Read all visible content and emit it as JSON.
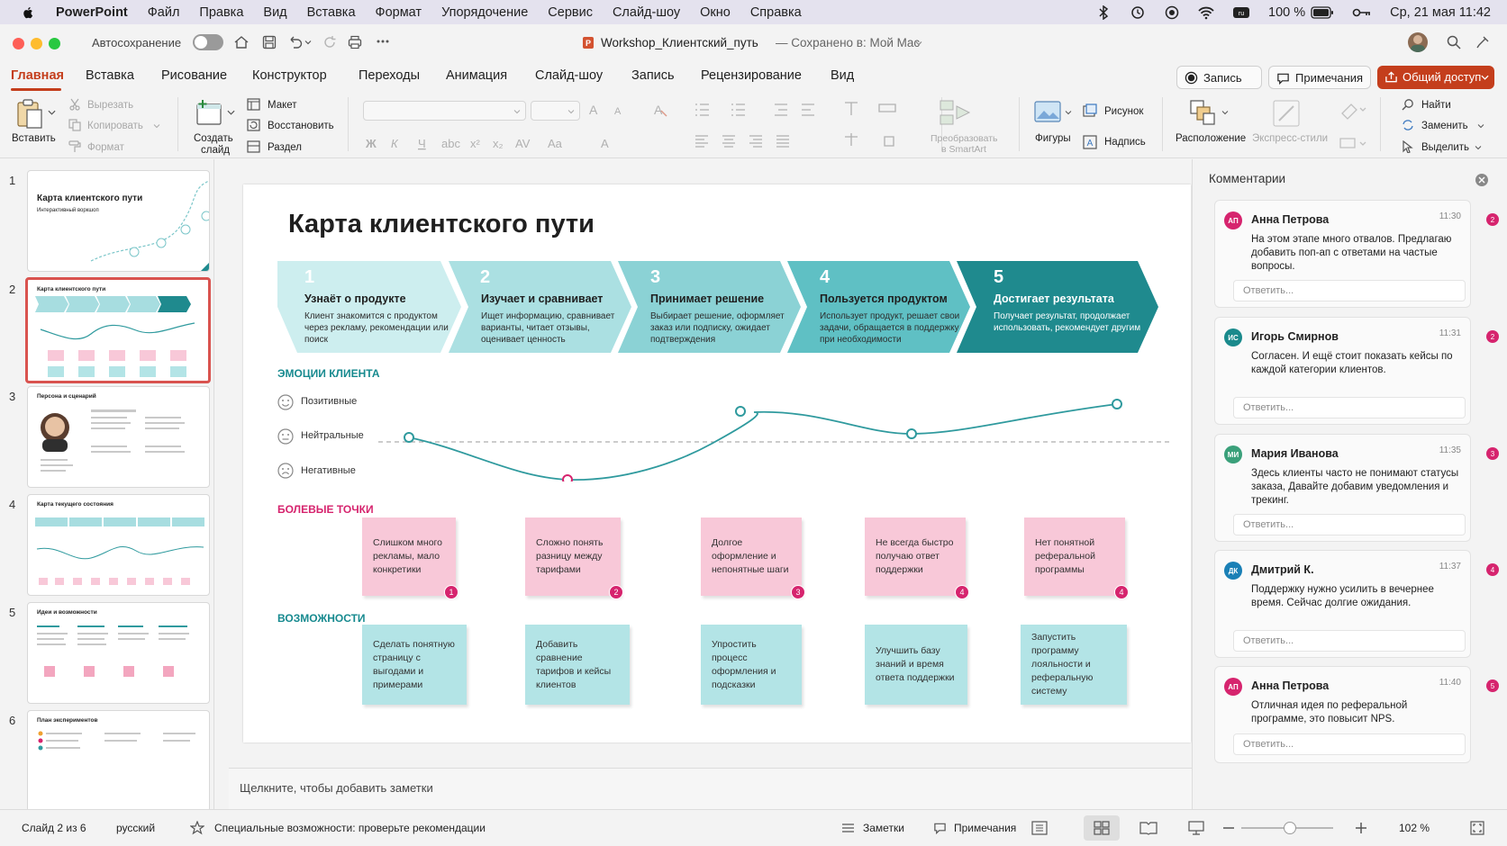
{
  "menubar": {
    "app": "PowerPoint",
    "items": [
      "Файл",
      "Правка",
      "Вид",
      "Вставка",
      "Формат",
      "Упорядочение",
      "Сервис",
      "Слайд-шоу",
      "Окно",
      "Справка"
    ],
    "battery": "100 %",
    "datetime": "Ср, 21 мая  11:42"
  },
  "titlebar": {
    "autosave_label": "Автосохранение",
    "doc_title": "Workshop_Клиентский_путь",
    "saved_status": "— Сохранено в: Мой Mac"
  },
  "tabs": [
    "Главная",
    "Вставка",
    "Рисование",
    "Конструктор",
    "Переходы",
    "Анимация",
    "Слайд-шоу",
    "Запись",
    "Рецензирование",
    "Вид"
  ],
  "header_buttons": {
    "record": "Запись",
    "comments": "Примечания",
    "share": "Общий доступ"
  },
  "ribbon": {
    "paste": "Вставить",
    "cut": "Вырезать",
    "copy": "Копировать",
    "format": "Формат",
    "new_slide_1": "Создать",
    "new_slide_2": "слайд",
    "layout": "Макет",
    "reset": "Восстановить",
    "section": "Раздел",
    "smartart_1": "Преобразовать",
    "smartart_2": "в SmartArt",
    "shapes": "Фигуры",
    "picture": "Рисунок",
    "textbox": "Надпись",
    "arrange": "Расположение",
    "quick_styles": "Экспресс-стили",
    "find": "Найти",
    "replace": "Заменить",
    "select": "Выделить"
  },
  "thumbnails": [
    {
      "num": "1",
      "title": "Карта клиентского пути",
      "subtitle": "Интерактивный воркшоп"
    },
    {
      "num": "2",
      "title": "Карта клиентского пути"
    },
    {
      "num": "3",
      "title": "Персона и сценарий"
    },
    {
      "num": "4",
      "title": "Карта текущего состояния"
    },
    {
      "num": "5",
      "title": "Идеи и возможности"
    },
    {
      "num": "6",
      "title": "План экспериментов"
    }
  ],
  "slide": {
    "title": "Карта клиентского пути",
    "stages": [
      {
        "num": "1",
        "title": "Узнаёт о продукте",
        "desc": "Клиент знакомится с продуктом через рекламу, рекомендации или поиск"
      },
      {
        "num": "2",
        "title": "Изучает и сравнивает",
        "desc": "Ищет информацию, сравнивает варианты, читает отзывы, оценивает ценность"
      },
      {
        "num": "3",
        "title": "Принимает решение",
        "desc": "Выбирает решение, оформляет заказ или подписку, ожидает подтверждения"
      },
      {
        "num": "4",
        "title": "Пользуется продуктом",
        "desc": "Использует продукт, решает свои задачи, обращается в поддержку при необходимости"
      },
      {
        "num": "5",
        "title": "Достигает результата",
        "desc": "Получает результат, продолжает использовать, рекомендует другим"
      }
    ],
    "emotions_title": "ЭМОЦИИ КЛИЕНТА",
    "emotion_levels": [
      "Позитивные",
      "Нейтральные",
      "Негативные"
    ],
    "pain_title": "БОЛЕВЫЕ ТОЧКИ",
    "pain_points": [
      {
        "text": "Слишком много рекламы, мало конкретики",
        "badge": "1"
      },
      {
        "text": "Сложно понять разницу между тарифами",
        "badge": "2"
      },
      {
        "text": "Долгое оформление и непонятные шаги",
        "badge": "3"
      },
      {
        "text": "Не всегда быстро получаю ответ поддержки",
        "badge": "4"
      },
      {
        "text": "Нет понятной реферальной программы",
        "badge": "4"
      }
    ],
    "opp_title": "ВОЗМОЖНОСТИ",
    "opportunities": [
      "Сделать понятную страницу с выгодами и примерами",
      "Добавить сравнение тарифов и кейсы клиентов",
      "Упростить процесс оформления и подсказки",
      "Улучшить базу знаний и время ответа поддержки",
      "Запустить программу лояльности и реферальную систему"
    ]
  },
  "notes_placeholder": "Щелкните, чтобы добавить заметки",
  "comments_panel": {
    "title": "Комментарии",
    "reply_placeholder": "Ответить...",
    "items": [
      {
        "initials": "АП",
        "author": "Анна Петрова",
        "time": "11:30",
        "text": "На этом этапе много отвалов. Предлагаю добавить поп-ап с ответами на частые вопросы.",
        "badge": "2",
        "color": "#d6246e"
      },
      {
        "initials": "ИС",
        "author": "Игорь Смирнов",
        "time": "11:31",
        "text": "Согласен. И ещё стоит показать кейсы по каждой категории клиентов.",
        "badge": "2",
        "color": "#1a8a8c"
      },
      {
        "initials": "МИ",
        "author": "Мария Иванова",
        "time": "11:35",
        "text": "Здесь клиенты часто не понимают статусы заказа, Давайте добавим уведомления и трекинг.",
        "badge": "3",
        "color": "#3aa07a"
      },
      {
        "initials": "ДК",
        "author": "Дмитрий К.",
        "time": "11:37",
        "text": "Поддержку нужно усилить в вечернее время. Сейчас долгие ожидания.",
        "badge": "4",
        "color": "#1a80b6"
      },
      {
        "initials": "АП",
        "author": "Анна Петрова",
        "time": "11:40",
        "text": "Отличная идея по реферальной программе, это повысит NPS.",
        "badge": "5",
        "color": "#d6246e"
      }
    ]
  },
  "statusbar": {
    "slide_info": "Слайд 2 из 6",
    "language": "русский",
    "accessibility": "Специальные возможности: проверьте рекомендации",
    "notes": "Заметки",
    "comments": "Примечания",
    "zoom": "102 %"
  }
}
